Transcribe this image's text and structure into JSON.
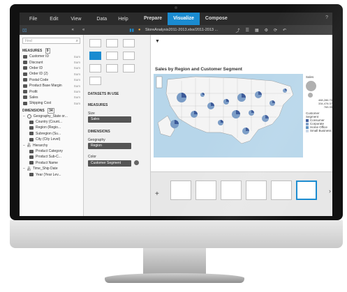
{
  "menu": {
    "file": "File",
    "edit": "Edit",
    "view": "View",
    "data": "Data",
    "help": "Help"
  },
  "modes": {
    "prepare": "Prepare",
    "visualize": "Visualize",
    "compose": "Compose"
  },
  "doc": {
    "name": "StoreAnalysis2011-2013.xlsx/2011-2013 ..."
  },
  "left": {
    "search_placeholder": "Find",
    "measures_title": "MEASURES",
    "measures_count": "9",
    "measures": [
      {
        "label": "Customer ID",
        "agg": "Sum"
      },
      {
        "label": "Discount",
        "agg": "Sum"
      },
      {
        "label": "Order ID",
        "agg": "Sum"
      },
      {
        "label": "Order ID (2)",
        "agg": "Sum"
      },
      {
        "label": "Postal Code",
        "agg": "Sum"
      },
      {
        "label": "Product Base Margin",
        "agg": "Sum"
      },
      {
        "label": "Profit",
        "agg": "Sum"
      },
      {
        "label": "Sales",
        "agg": "Sum"
      },
      {
        "label": "Shipping Cost",
        "agg": "Sum"
      }
    ],
    "dimensions_title": "DIMENSIONS",
    "dimensions_count": "34",
    "geo": "Geography_State or...",
    "geo_items": [
      "Country (Count...",
      "Region (Regio...",
      "Subregion (Su...",
      "City (City Level)"
    ],
    "hierarchy": "Hierarchy",
    "hier_items": [
      "Product Category",
      "Product Sub-C...",
      "Product Name"
    ],
    "time": "Time_Ship Date",
    "time_items": [
      "Year (Year Lev..."
    ]
  },
  "mid": {
    "datasets": "DATASETS IN USE",
    "measures": "MEASURES",
    "size": "Size",
    "sales": "Sales",
    "dimensions": "DIMENSIONS",
    "geography": "Geography",
    "region": "Region",
    "color": "Color",
    "customer_segment": "Customer Segment"
  },
  "chart": {
    "title": "Sales by Region and Customer Segment",
    "legend_title": "Sales",
    "legend_values": [
      "468,286.70",
      "334,478.37",
      "765.39"
    ],
    "segment_title": "Customer Segment",
    "segments": [
      "Consumer",
      "Corporate",
      "Home Office",
      "Small Business"
    ],
    "segment_colors": [
      "#3b5998",
      "#7a9cc6",
      "#5a8fbf",
      "#c7d5e6"
    ]
  }
}
